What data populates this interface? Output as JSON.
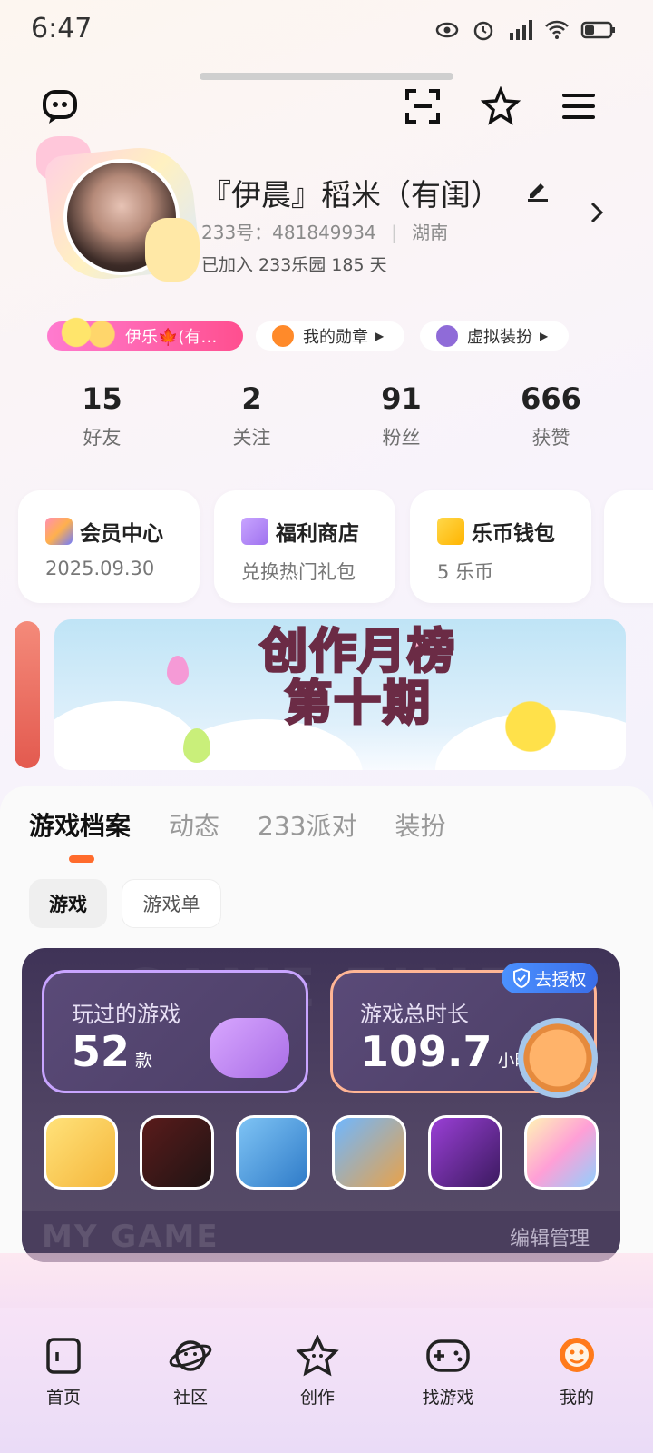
{
  "status": {
    "time": "6:47"
  },
  "profile": {
    "name": "『伊晨』稻米（有闺）",
    "uid": "233号：481849934",
    "region": "湖南",
    "joined": "已加入 233乐园 185 天"
  },
  "pills": {
    "vip_label": "伊乐🍁(有…",
    "badge_label": "我的勋章",
    "dress_label": "虚拟装扮"
  },
  "stats": [
    {
      "num": "15",
      "label": "好友"
    },
    {
      "num": "2",
      "label": "关注"
    },
    {
      "num": "91",
      "label": "粉丝"
    },
    {
      "num": "666",
      "label": "获赞"
    }
  ],
  "cards": [
    {
      "title": "会员中心",
      "sub": "2025.09.30"
    },
    {
      "title": "福利商店",
      "sub": "兑换热门礼包"
    },
    {
      "title": "乐币钱包",
      "sub": "5 乐币"
    }
  ],
  "banner": {
    "line1": "创作月榜",
    "line2": "第十期"
  },
  "tabs": [
    "游戏档案",
    "动态",
    "233派对",
    "装扮"
  ],
  "chips": [
    "游戏",
    "游戏单"
  ],
  "game_panel": {
    "played_label": "玩过的游戏",
    "played_value": "52",
    "played_unit": "款",
    "time_label": "游戏总时长",
    "time_value": "109.7",
    "time_unit": "小时",
    "auth_label": "去授权",
    "edit_label": "编辑管理",
    "ghost_top": "GAME TIME",
    "ghost_bottom": "MY GAME"
  },
  "nav": [
    {
      "label": "首页",
      "icon": "home-icon"
    },
    {
      "label": "社区",
      "icon": "planet-icon"
    },
    {
      "label": "创作",
      "icon": "star-create-icon"
    },
    {
      "label": "找游戏",
      "icon": "gamepad-icon"
    },
    {
      "label": "我的",
      "icon": "profile-icon"
    }
  ],
  "colors": {
    "accent": "#ff6b2c",
    "vip_pink": "#ff4f8f",
    "panel": "#4a3e5d"
  }
}
